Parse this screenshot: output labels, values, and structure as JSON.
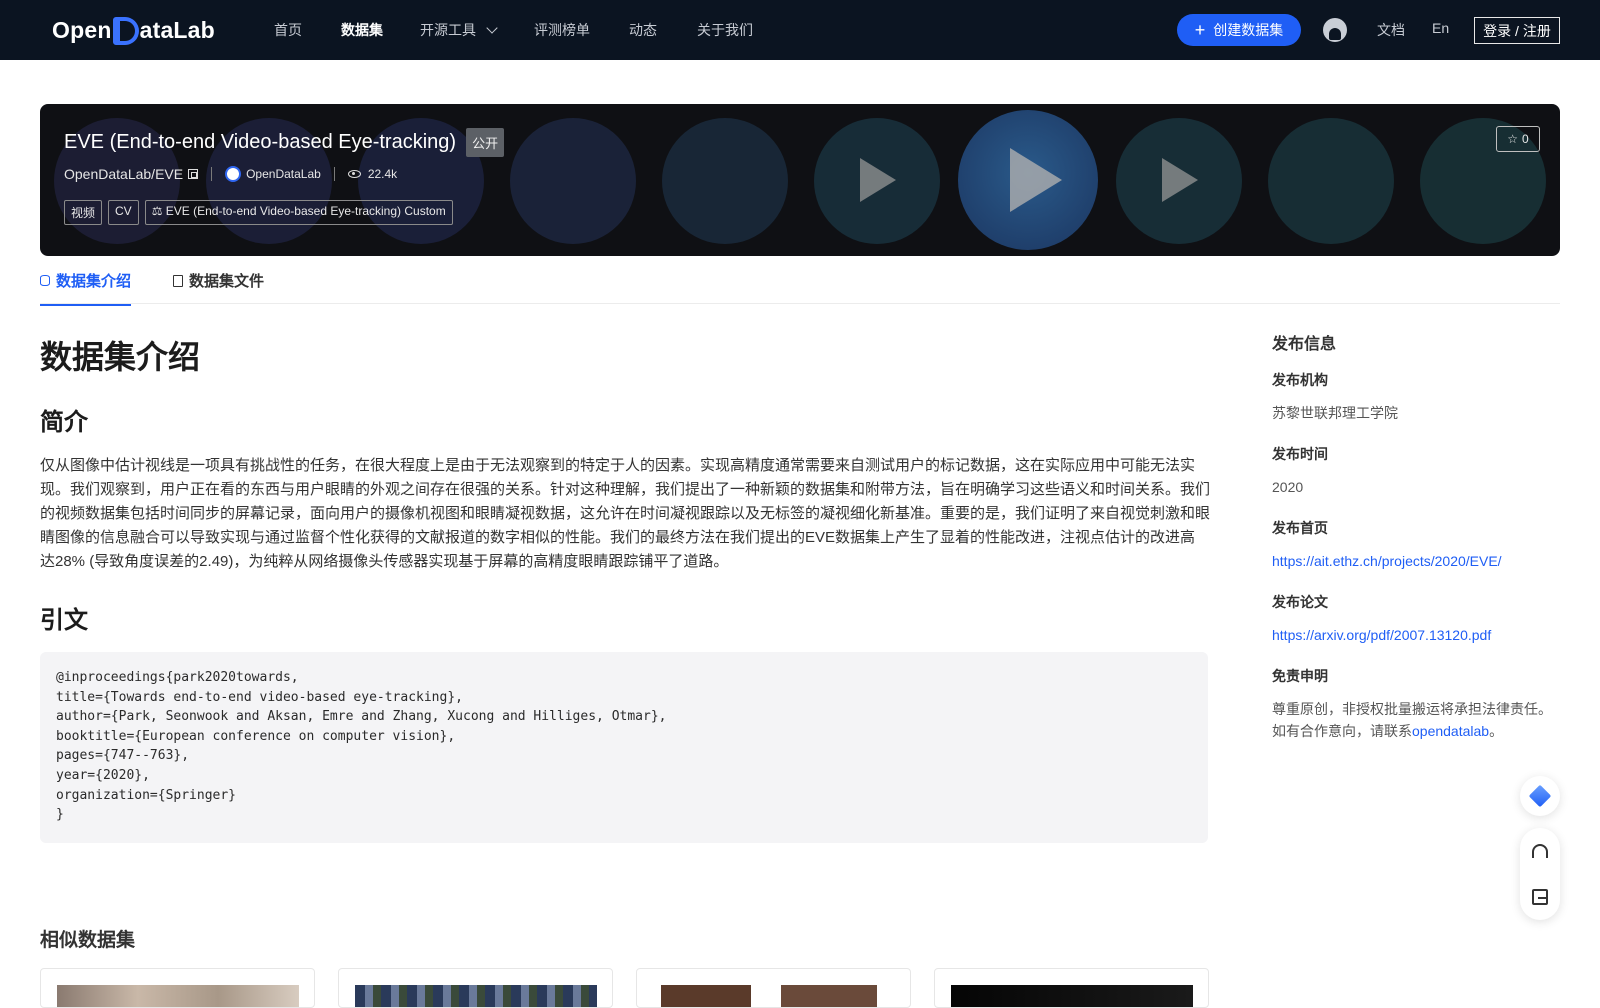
{
  "nav": {
    "logo": "OpenDataLab",
    "items": [
      {
        "label": "首页",
        "active": false
      },
      {
        "label": "数据集",
        "active": true
      },
      {
        "label": "开源工具",
        "active": false,
        "dropdown": true
      },
      {
        "label": "评测榜单",
        "active": false
      },
      {
        "label": "动态",
        "active": false
      },
      {
        "label": "关于我们",
        "active": false
      }
    ],
    "create_label": "创建数据集",
    "docs_label": "文档",
    "lang_label": "En",
    "login_label": "登录 / 注册"
  },
  "hero": {
    "title": "EVE (End-to-end Video-based Eye-tracking)",
    "visibility": "公开",
    "repo": "OpenDataLab/EVE",
    "org": "OpenDataLab",
    "views": "22.4k",
    "tags": [
      "视频",
      "CV",
      "⚖ EVE (End-to-end Video-based Eye-tracking) Custom"
    ],
    "stars": "0"
  },
  "tabs": [
    {
      "label": "数据集介绍",
      "icon": "database-icon",
      "active": true
    },
    {
      "label": "数据集文件",
      "icon": "file-icon",
      "active": false
    }
  ],
  "article": {
    "heading": "数据集介绍",
    "intro_heading": "简介",
    "intro_text": "仅从图像中估计视线是一项具有挑战性的任务，在很大程度上是由于无法观察到的特定于人的因素。实现高精度通常需要来自测试用户的标记数据，这在实际应用中可能无法实现。我们观察到，用户正在看的东西与用户眼睛的外观之间存在很强的关系。针对这种理解，我们提出了一种新颖的数据集和附带方法，旨在明确学习这些语义和时间关系。我们的视频数据集包括时间同步的屏幕记录，面向用户的摄像机视图和眼睛凝视数据，这允许在时间凝视跟踪以及无标签的凝视细化新基准。重要的是，我们证明了来自视觉刺激和眼睛图像的信息融合可以导致实现与通过监督个性化获得的文献报道的数字相似的性能。我们的最终方法在我们提出的EVE数据集上产生了显着的性能改进，注视点估计的改进高达28% (导致角度误差的2.49)，为纯粹从网络摄像头传感器实现基于屏幕的高精度眼睛跟踪铺平了道路。",
    "citation_heading": "引文",
    "citation_lines": [
      "@inproceedings{park2020towards,",
      "title={Towards end-to-end video-based eye-tracking},",
      "author={Park, Seonwook and Aksan, Emre and Zhang, Xucong and Hilliges, Otmar},",
      "booktitle={European conference on computer vision},",
      "pages={747--763},",
      "year={2020},",
      "organization={Springer}",
      "}"
    ]
  },
  "sidebar": {
    "title": "发布信息",
    "org_label": "发布机构",
    "org_value": "苏黎世联邦理工学院",
    "time_label": "发布时间",
    "time_value": "2020",
    "homepage_label": "发布首页",
    "homepage_value": "https://ait.ethz.ch/projects/2020/EVE/",
    "paper_label": "发布论文",
    "paper_value": "https://arxiv.org/pdf/2007.13120.pdf",
    "disclaimer_label": "免责申明",
    "disclaimer_text_1": "尊重原创，非授权批量搬运将承担法律责任。",
    "disclaimer_text_2": "如有合作意向，请联系",
    "disclaimer_link": "opendatalab",
    "disclaimer_end": "。"
  },
  "similar": {
    "title": "相似数据集"
  },
  "colors": {
    "nav_bg": "#0b1421",
    "accent": "#1f5ef5",
    "hero_bg": "#0f1014"
  }
}
